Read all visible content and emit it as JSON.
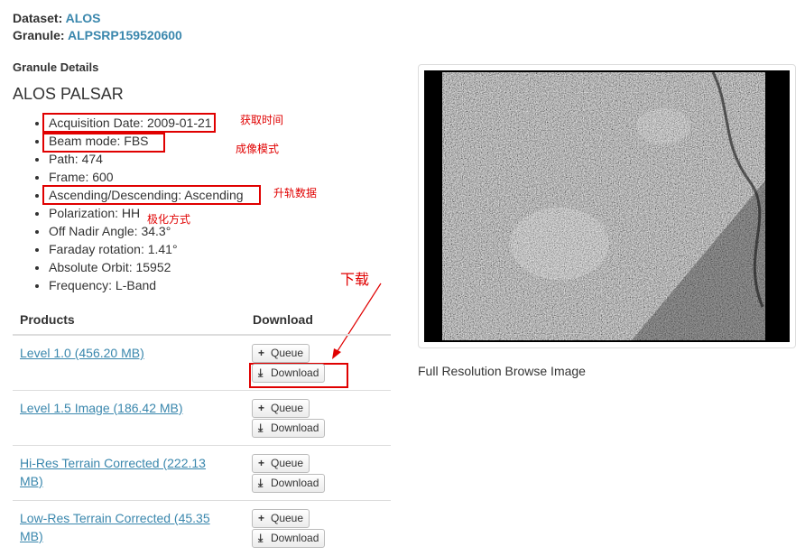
{
  "dataset": {
    "label": "Dataset:",
    "value": "ALOS"
  },
  "granule": {
    "label": "Granule:",
    "value": "ALPSRP159520600"
  },
  "details_heading": "Granule Details",
  "product_title": "ALOS PALSAR",
  "properties": [
    "Acquisition Date: 2009-01-21",
    "Beam mode: FBS",
    "Path: 474",
    "Frame: 600",
    "Ascending/Descending: Ascending",
    "Polarization: HH",
    "Off Nadir Angle: 34.3°",
    "Faraday rotation: 1.41°",
    "Absolute Orbit: 15952",
    "Frequency: L-Band"
  ],
  "annotations": {
    "acquisition": "获取时间",
    "beam": "成像模式",
    "direction": "升轨数据",
    "polarization": "极化方式",
    "download": "下载",
    "color": "#e00000"
  },
  "table": {
    "col_products": "Products",
    "col_download": "Download",
    "queue_label": "Queue",
    "download_label": "Download",
    "rows": [
      {
        "label": "Level 1.0 (456.20 MB)"
      },
      {
        "label": "Level 1.5 Image (186.42 MB)"
      },
      {
        "label": "Hi-Res Terrain Corrected (222.13 MB)"
      },
      {
        "label": "Low-Res Terrain Corrected (45.35 MB)"
      }
    ]
  },
  "browse_caption": "Full Resolution Browse Image",
  "colors": {
    "link": "#3a87ad",
    "text": "#333333",
    "annotation": "#e00000"
  },
  "icons": {
    "queue": "plus-icon",
    "download": "download-icon"
  }
}
